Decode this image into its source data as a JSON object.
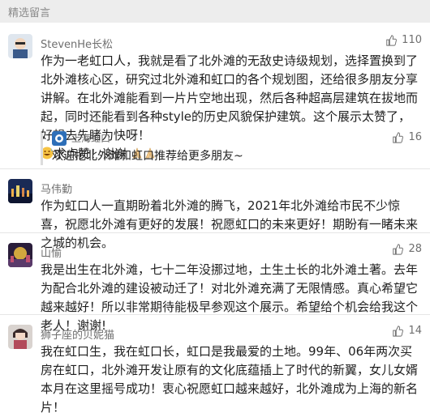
{
  "section": {
    "title": "精选留言"
  },
  "comments": [
    {
      "nickname": "StevenHe长松",
      "likes": "110",
      "text": "作为一老虹口人，我就是看了北外滩的无敌史诗级规划，选择置换到了北外滩核心区，研究过北外滩和虹口的各个规划图，还给很多朋友分享讲解。在北外滩能看到一片片空地出现，然后各种超高层建筑在拔地而起，同时还能看到各种style的历史风貌保护建筑。这个展示太赞了，好想去先睹为快呀！",
      "text_tail": "求点赞！谢谢",
      "emoji_lead": "grinning-sweat-emoji",
      "emoji_tail": [
        "praying-hands-emoji",
        "praying-hands-emoji"
      ],
      "reply": {
        "nickname": "上海虹口",
        "likes": "16",
        "text": "欢迎把北外滩和虹口推荐给更多朋友~"
      }
    },
    {
      "nickname": "马伟勤",
      "likes": "",
      "text": "作为虹口人一直期盼着北外滩的腾飞，2021年北外滩给市民不少惊喜，祝愿北外滩有更好的发展！祝愿虹口的未来更好！期盼有一睹未来之城的机会。"
    },
    {
      "nickname": "山愉",
      "likes": "28",
      "text": "我是出生在北外滩，七十二年没挪过地，土生土长的北外滩土著。去年为配合北外滩的建设被动迁了！对北外滩充满了无限情感。真心希望它越来越好！所以非常期待能极早参观这个展示。希望给个机会给我这个老人！谢谢!"
    },
    {
      "nickname": "狮子座的贝妮猫",
      "likes": "14",
      "text": "我在虹口生，我在虹口长，虹口是我最爱的土地。99年、06年两次买房在虹口，北外滩开发让原有的文化底蕴插上了时代的新翼，女儿女婿本月在这里摇号成功！衷心祝愿虹口越来越好，北外滩成为上海的新名片！"
    }
  ],
  "colors": {
    "header_bg": "#ededed",
    "meta_text": "#6f6f6f",
    "body_text": "#1f1f1f"
  },
  "icons": {
    "like": "thumbs-up-icon"
  }
}
